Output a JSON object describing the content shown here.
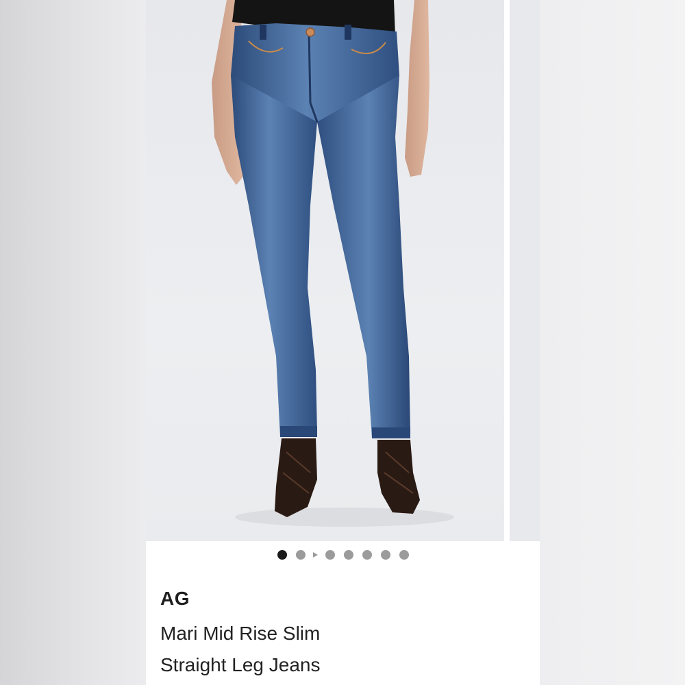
{
  "product": {
    "brand": "AG",
    "title_line1": "Mari Mid Rise Slim",
    "title_line2": "Straight Leg Jeans"
  },
  "carousel": {
    "total_dots": 7,
    "active_index": 0,
    "play_icon": "play-icon"
  },
  "colors": {
    "denim": "#3a5f90",
    "denim_dark": "#24406b",
    "top": "#141414",
    "boots": "#2a1a14",
    "dot_active": "#1b1b1b",
    "dot_inactive": "#9b9b9b"
  }
}
